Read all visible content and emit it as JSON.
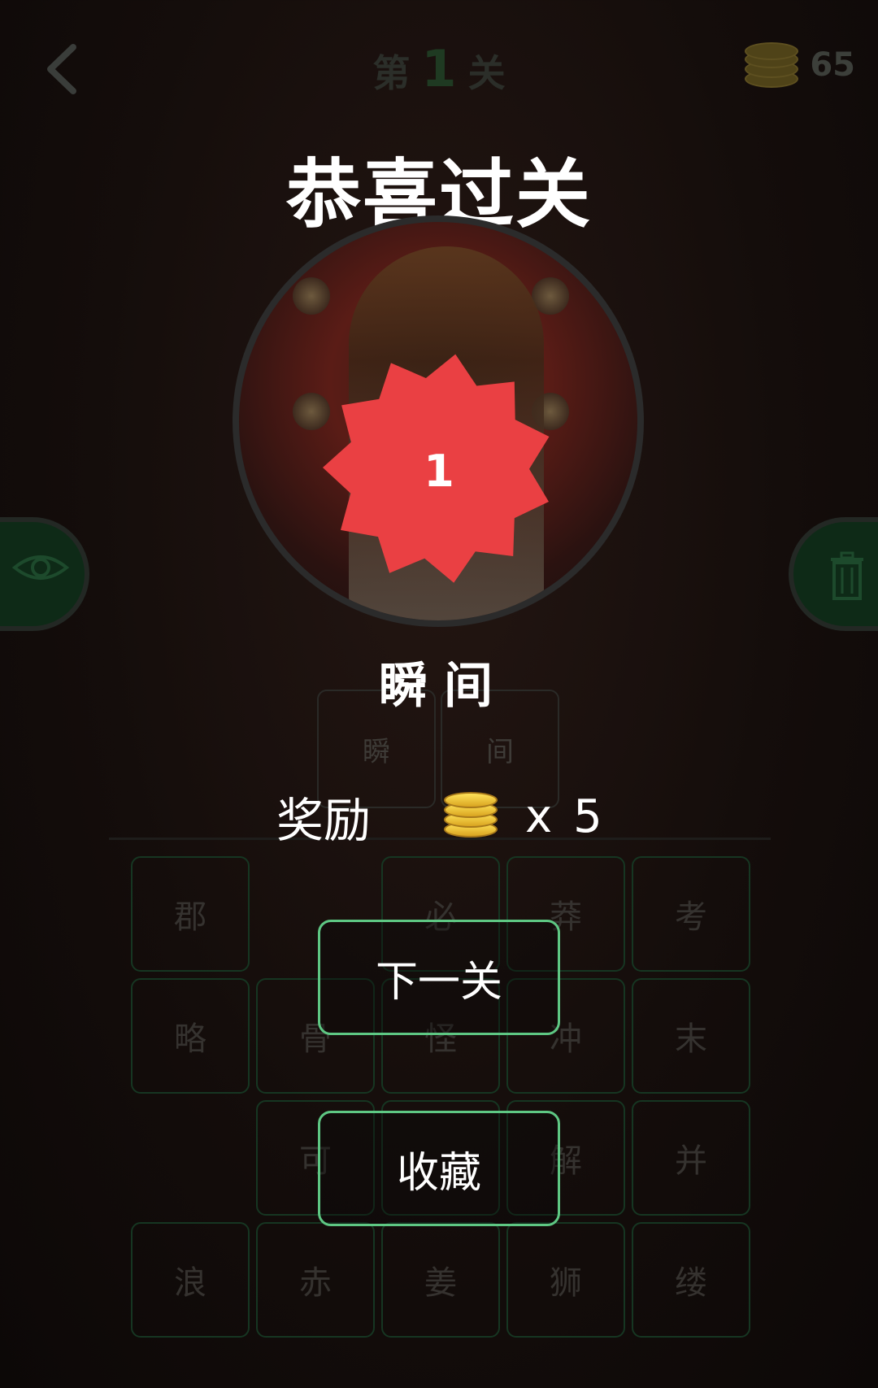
{
  "header": {
    "level_prefix": "第",
    "level_number": "1",
    "level_suffix": "关",
    "coins": "65"
  },
  "side_buttons": {
    "left_icon": "eye-icon",
    "right_icon": "trash-icon"
  },
  "answer_slots": [
    "瞬",
    "间"
  ],
  "letter_grid": [
    [
      "郡",
      "",
      "必",
      "莽",
      "考"
    ],
    [
      "略",
      "骨",
      "怪",
      "冲",
      "末"
    ],
    [
      "",
      "可",
      "",
      "解",
      "并"
    ],
    [
      "浪",
      "赤",
      "姜",
      "狮",
      "缕"
    ]
  ],
  "overlay": {
    "title": "恭喜过关",
    "badge_number": "1",
    "answer_chars": [
      "瞬",
      "间"
    ],
    "reward_label": "奖励",
    "reward_x": "x",
    "reward_amount": "5",
    "next_button": "下一关",
    "favorite_button": "收藏"
  },
  "colors": {
    "badge": "#ea4043",
    "button_border": "#5ec783",
    "coin": "#f3c33a"
  }
}
